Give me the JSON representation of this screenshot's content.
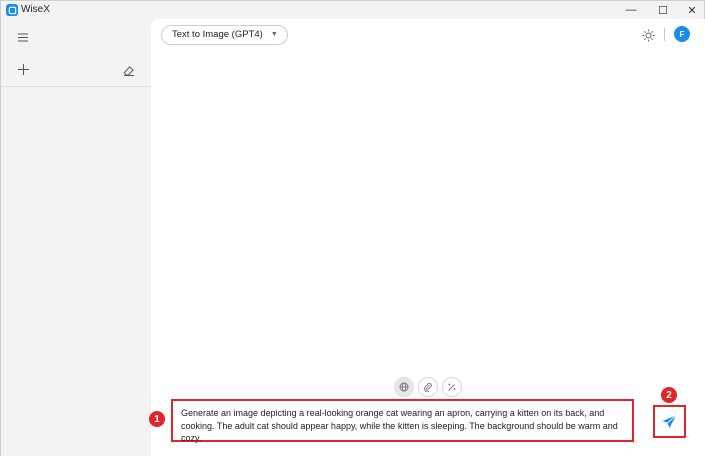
{
  "window": {
    "title": "WiseX",
    "controls": {
      "minimize": "—",
      "maximize": "☐",
      "close": "✕"
    }
  },
  "sidebar": {
    "icons": [
      "menu-icon",
      "plus-icon",
      "eraser-icon"
    ]
  },
  "header": {
    "model_select": "Text to Image (GPT4)",
    "theme_icon": "sun-icon",
    "avatar_initial": "F"
  },
  "toolbar": {
    "icons": [
      "globe-icon",
      "paperclip-icon",
      "magic-icon"
    ]
  },
  "prompt": {
    "text": "Generate an image depicting a real-looking orange cat wearing an apron, carrying a kitten on its back, and cooking. The adult cat should appear happy, while the kitten is sleeping. The background should be warm and cozy."
  },
  "annotations": {
    "badge1": "1",
    "badge2": "2"
  },
  "colors": {
    "accent": "#1a8cf0",
    "annotation": "#e0262a"
  }
}
